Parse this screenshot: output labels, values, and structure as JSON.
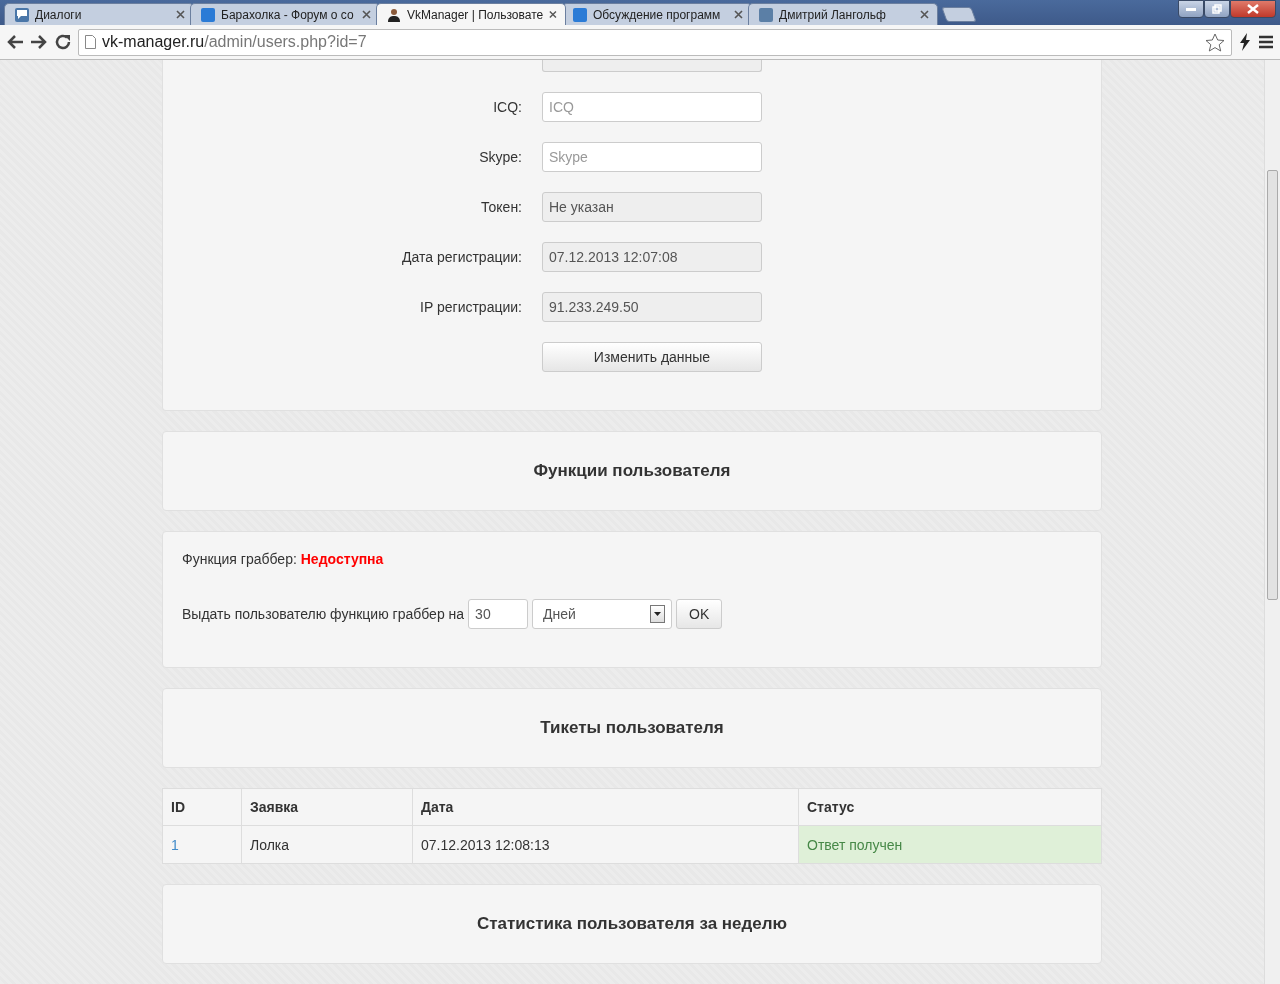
{
  "browser": {
    "tabs": [
      {
        "title": "Диалоги",
        "selected": false
      },
      {
        "title": "Барахолка - Форум о со",
        "selected": false
      },
      {
        "title": "VkManager | Пользовате",
        "selected": true
      },
      {
        "title": "Обсуждение программ",
        "selected": false
      },
      {
        "title": "Дмитрий Лангольф",
        "selected": false
      }
    ],
    "url_host": "vk-manager.ru",
    "url_path": "/admin/users.php?id=7"
  },
  "profile_form": {
    "fields": [
      {
        "label": "ICQ:",
        "placeholder": "ICQ",
        "disabled": false
      },
      {
        "label": "Skype:",
        "placeholder": "Skype",
        "disabled": false
      },
      {
        "label": "Токен:",
        "value": "Не указан",
        "disabled": true
      },
      {
        "label": "Дата регистрации:",
        "value": "07.12.2013 12:07:08",
        "disabled": true
      },
      {
        "label": "IP регистрации:",
        "value": "91.233.249.50",
        "disabled": true
      }
    ],
    "submit": "Изменить данные"
  },
  "functions_heading": "Функции пользователя",
  "grabber": {
    "status_label": "Функция граббер:",
    "status_value": "Недоступна",
    "grant_label": "Выдать пользователю функцию граббер на",
    "amount": "30",
    "unit": "Дней",
    "ok": "OK"
  },
  "tickets_heading": "Тикеты пользователя",
  "tickets": {
    "columns": [
      "ID",
      "Заявка",
      "Дата",
      "Статус"
    ],
    "rows": [
      {
        "id": "1",
        "subject": "Лолка",
        "date": "07.12.2013 12:08:13",
        "status": "Ответ получен"
      }
    ]
  },
  "stats_heading": "Статистика пользователя за неделю"
}
